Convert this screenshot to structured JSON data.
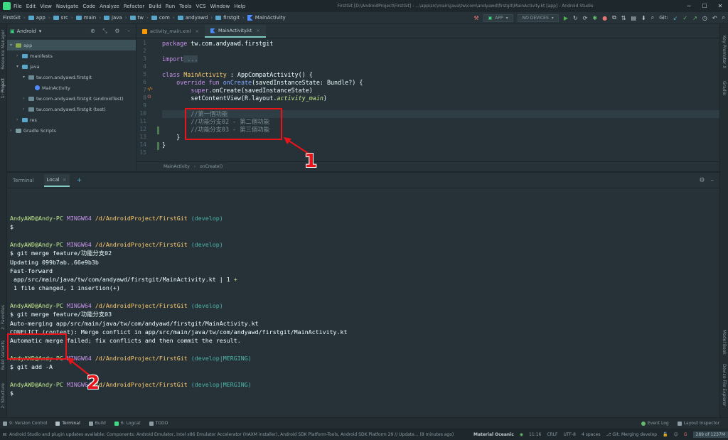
{
  "titlebar": {
    "menu": [
      "File",
      "Edit",
      "View",
      "Navigate",
      "Code",
      "Analyze",
      "Refactor",
      "Build",
      "Run",
      "Tools",
      "VCS",
      "Window",
      "Help"
    ],
    "window_title": "FirstGit [D:\\AndroidProject\\FirstGit] - ...\\app\\src\\main\\java\\tw\\com\\andyawd\\firstgit\\MainActivity.kt [app] - Android Studio",
    "minimize": "─",
    "maximize": "☐",
    "close": "✕"
  },
  "navbar": {
    "breadcrumbs": [
      "FirstGit",
      "app",
      "src",
      "main",
      "java",
      "tw",
      "com",
      "andyawd",
      "firstgit",
      "MainActivity"
    ],
    "run_config": "APP",
    "device": "NO DEVICES",
    "git_label": "Git:"
  },
  "left_tools": [
    "Resource Manager",
    "1: Project",
    "2: Favorites",
    "Build Variants",
    "2: Structure"
  ],
  "right_tools": [
    "Key Promoter X",
    "Gradle",
    "Model Book",
    "Device File Explorer"
  ],
  "project": {
    "view": "Android",
    "tree": [
      {
        "label": "app",
        "indent": 0,
        "arrow": "▾",
        "icon": "folder-green",
        "selected": true
      },
      {
        "label": "manifests",
        "indent": 1,
        "arrow": "›",
        "icon": "folder"
      },
      {
        "label": "java",
        "indent": 1,
        "arrow": "▾",
        "icon": "folder"
      },
      {
        "label": "tw.com.andyawd.firstgit",
        "indent": 2,
        "arrow": "▾",
        "icon": "package"
      },
      {
        "label": "MainActivity",
        "indent": 3,
        "arrow": "",
        "icon": "class"
      },
      {
        "label": "tw.com.andyawd.firstgit (androidTest)",
        "indent": 2,
        "arrow": "›",
        "icon": "package"
      },
      {
        "label": "tw.com.andyawd.firstgit (test)",
        "indent": 2,
        "arrow": "›",
        "icon": "package"
      },
      {
        "label": "res",
        "indent": 1,
        "arrow": "›",
        "icon": "folder"
      },
      {
        "label": "Gradle Scripts",
        "indent": 0,
        "arrow": "›",
        "icon": "gradle"
      }
    ]
  },
  "editor": {
    "tabs": [
      {
        "label": "activity_main.xml",
        "active": false
      },
      {
        "label": "MainActivity.kt",
        "active": true
      }
    ],
    "line_numbers": [
      "1",
      "2",
      "3",
      "4",
      "5",
      "6",
      "7",
      "8",
      "9",
      "10",
      "11",
      "12",
      "13",
      "14",
      "15"
    ],
    "code": {
      "l1_kw": "package",
      "l1_rest": " tw.com.andyawd.firstgit",
      "l3_kw": "import",
      "l3_rest": " ...",
      "l6_kw": "class",
      "l6_name": " MainActivity ",
      "l6_rest": ": AppCompatActivity() {",
      "l7_kw": "override fun",
      "l7_fn": " onCreate",
      "l7_rest": "(savedInstanceState: Bundle?) {",
      "l8_kw": "super",
      "l8_rest": ".onCreate(savedInstanceState)",
      "l9_a": "setContentView(R.layout.",
      "l9_it": "activity_main",
      "l9_b": ")",
      "l11": "//第一個功能",
      "l12": "//功能分支02 - 第二個功能",
      "l13": "//功能分支03 - 第三個功能",
      "l14": "}",
      "l15": "}"
    },
    "breadcrumb": [
      "MainActivity",
      "onCreate()"
    ]
  },
  "terminal": {
    "tabs": [
      "Terminal",
      "Local"
    ],
    "lines": [
      {
        "t": "prompt",
        "user": "AndyAWD@Andy-PC",
        "env": "MINGW64",
        "path": "/d/AndroidProject/FirstGit",
        "branch": "(develop)"
      },
      {
        "t": "text",
        "v": "$"
      },
      {
        "t": "blank"
      },
      {
        "t": "prompt",
        "user": "AndyAWD@Andy-PC",
        "env": "MINGW64",
        "path": "/d/AndroidProject/FirstGit",
        "branch": "(develop)"
      },
      {
        "t": "text",
        "v": "$ git merge feature/功能分支02"
      },
      {
        "t": "text",
        "v": "Updating 099b7ab..66e9b3b"
      },
      {
        "t": "text",
        "v": "Fast-forward"
      },
      {
        "t": "diff",
        "v": " app/src/main/java/tw/com/andyawd/firstgit/MainActivity.kt | 1 ",
        "plus": "+"
      },
      {
        "t": "text",
        "v": " 1 file changed, 1 insertion(+)"
      },
      {
        "t": "blank"
      },
      {
        "t": "prompt",
        "user": "AndyAWD@Andy-PC",
        "env": "MINGW64",
        "path": "/d/AndroidProject/FirstGit",
        "branch": "(develop)"
      },
      {
        "t": "text",
        "v": "$ git merge feature/功能分支03"
      },
      {
        "t": "text",
        "v": "Auto-merging app/src/main/java/tw/com/andyawd/firstgit/MainActivity.kt"
      },
      {
        "t": "text",
        "v": "CONFLICT (content): Merge conflict in app/src/main/java/tw/com/andyawd/firstgit/MainActivity.kt"
      },
      {
        "t": "text",
        "v": "Automatic merge failed; fix conflicts and then commit the result."
      },
      {
        "t": "blank"
      },
      {
        "t": "prompt",
        "user": "AndyAWD@Andy-PC",
        "env": "MINGW64",
        "path": "/d/AndroidProject/FirstGit",
        "branch": "(develop|MERGING)"
      },
      {
        "t": "text",
        "v": "$ git add -A"
      },
      {
        "t": "blank"
      },
      {
        "t": "prompt",
        "user": "AndyAWD@Andy-PC",
        "env": "MINGW64",
        "path": "/d/AndroidProject/FirstGit",
        "branch": "(develop|MERGING)"
      },
      {
        "t": "text",
        "v": "$"
      }
    ]
  },
  "bottom_tabs": [
    "9: Version Control",
    "Terminal",
    "Build",
    "6: Logcat",
    "TODO"
  ],
  "bottom_right": [
    "Event Log",
    "Layout Inspector"
  ],
  "statusbar": {
    "message": "Android Studio and plugin updates available: Components: Android Emulator, Intel x86 Emulator Accelerator (HAXM installer), Android SDK Platform-Tools, Android SDK Platform 29 // Update... (8 minutes ago)",
    "theme": "Material Oceanic",
    "position": "11:16",
    "line_sep": "CRLF",
    "encoding": "UTF-8",
    "indent": "4 spaces",
    "git": "Git: Merging develop",
    "memory": "289 of 1237M"
  },
  "annotations": {
    "label1": "1",
    "label2": "2"
  },
  "colors": {
    "accent": "#80cbc4",
    "annotation": "#e8141a",
    "keyword": "#c792ea",
    "function": "#82aaff"
  }
}
